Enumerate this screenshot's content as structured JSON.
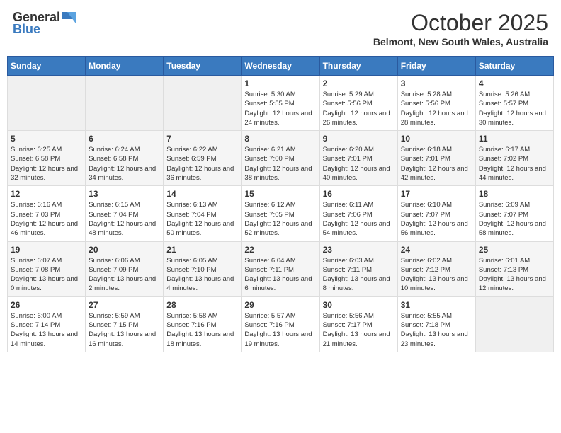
{
  "logo": {
    "general": "General",
    "blue": "Blue"
  },
  "title": "October 2025",
  "location": "Belmont, New South Wales, Australia",
  "headers": [
    "Sunday",
    "Monday",
    "Tuesday",
    "Wednesday",
    "Thursday",
    "Friday",
    "Saturday"
  ],
  "weeks": [
    [
      {
        "day": "",
        "empty": true
      },
      {
        "day": "",
        "empty": true
      },
      {
        "day": "",
        "empty": true
      },
      {
        "day": "1",
        "sunrise": "Sunrise: 5:30 AM",
        "sunset": "Sunset: 5:55 PM",
        "daylight": "Daylight: 12 hours and 24 minutes."
      },
      {
        "day": "2",
        "sunrise": "Sunrise: 5:29 AM",
        "sunset": "Sunset: 5:56 PM",
        "daylight": "Daylight: 12 hours and 26 minutes."
      },
      {
        "day": "3",
        "sunrise": "Sunrise: 5:28 AM",
        "sunset": "Sunset: 5:56 PM",
        "daylight": "Daylight: 12 hours and 28 minutes."
      },
      {
        "day": "4",
        "sunrise": "Sunrise: 5:26 AM",
        "sunset": "Sunset: 5:57 PM",
        "daylight": "Daylight: 12 hours and 30 minutes."
      }
    ],
    [
      {
        "day": "5",
        "sunrise": "Sunrise: 6:25 AM",
        "sunset": "Sunset: 6:58 PM",
        "daylight": "Daylight: 12 hours and 32 minutes."
      },
      {
        "day": "6",
        "sunrise": "Sunrise: 6:24 AM",
        "sunset": "Sunset: 6:58 PM",
        "daylight": "Daylight: 12 hours and 34 minutes."
      },
      {
        "day": "7",
        "sunrise": "Sunrise: 6:22 AM",
        "sunset": "Sunset: 6:59 PM",
        "daylight": "Daylight: 12 hours and 36 minutes."
      },
      {
        "day": "8",
        "sunrise": "Sunrise: 6:21 AM",
        "sunset": "Sunset: 7:00 PM",
        "daylight": "Daylight: 12 hours and 38 minutes."
      },
      {
        "day": "9",
        "sunrise": "Sunrise: 6:20 AM",
        "sunset": "Sunset: 7:01 PM",
        "daylight": "Daylight: 12 hours and 40 minutes."
      },
      {
        "day": "10",
        "sunrise": "Sunrise: 6:18 AM",
        "sunset": "Sunset: 7:01 PM",
        "daylight": "Daylight: 12 hours and 42 minutes."
      },
      {
        "day": "11",
        "sunrise": "Sunrise: 6:17 AM",
        "sunset": "Sunset: 7:02 PM",
        "daylight": "Daylight: 12 hours and 44 minutes."
      }
    ],
    [
      {
        "day": "12",
        "sunrise": "Sunrise: 6:16 AM",
        "sunset": "Sunset: 7:03 PM",
        "daylight": "Daylight: 12 hours and 46 minutes."
      },
      {
        "day": "13",
        "sunrise": "Sunrise: 6:15 AM",
        "sunset": "Sunset: 7:04 PM",
        "daylight": "Daylight: 12 hours and 48 minutes."
      },
      {
        "day": "14",
        "sunrise": "Sunrise: 6:13 AM",
        "sunset": "Sunset: 7:04 PM",
        "daylight": "Daylight: 12 hours and 50 minutes."
      },
      {
        "day": "15",
        "sunrise": "Sunrise: 6:12 AM",
        "sunset": "Sunset: 7:05 PM",
        "daylight": "Daylight: 12 hours and 52 minutes."
      },
      {
        "day": "16",
        "sunrise": "Sunrise: 6:11 AM",
        "sunset": "Sunset: 7:06 PM",
        "daylight": "Daylight: 12 hours and 54 minutes."
      },
      {
        "day": "17",
        "sunrise": "Sunrise: 6:10 AM",
        "sunset": "Sunset: 7:07 PM",
        "daylight": "Daylight: 12 hours and 56 minutes."
      },
      {
        "day": "18",
        "sunrise": "Sunrise: 6:09 AM",
        "sunset": "Sunset: 7:07 PM",
        "daylight": "Daylight: 12 hours and 58 minutes."
      }
    ],
    [
      {
        "day": "19",
        "sunrise": "Sunrise: 6:07 AM",
        "sunset": "Sunset: 7:08 PM",
        "daylight": "Daylight: 13 hours and 0 minutes."
      },
      {
        "day": "20",
        "sunrise": "Sunrise: 6:06 AM",
        "sunset": "Sunset: 7:09 PM",
        "daylight": "Daylight: 13 hours and 2 minutes."
      },
      {
        "day": "21",
        "sunrise": "Sunrise: 6:05 AM",
        "sunset": "Sunset: 7:10 PM",
        "daylight": "Daylight: 13 hours and 4 minutes."
      },
      {
        "day": "22",
        "sunrise": "Sunrise: 6:04 AM",
        "sunset": "Sunset: 7:11 PM",
        "daylight": "Daylight: 13 hours and 6 minutes."
      },
      {
        "day": "23",
        "sunrise": "Sunrise: 6:03 AM",
        "sunset": "Sunset: 7:11 PM",
        "daylight": "Daylight: 13 hours and 8 minutes."
      },
      {
        "day": "24",
        "sunrise": "Sunrise: 6:02 AM",
        "sunset": "Sunset: 7:12 PM",
        "daylight": "Daylight: 13 hours and 10 minutes."
      },
      {
        "day": "25",
        "sunrise": "Sunrise: 6:01 AM",
        "sunset": "Sunset: 7:13 PM",
        "daylight": "Daylight: 13 hours and 12 minutes."
      }
    ],
    [
      {
        "day": "26",
        "sunrise": "Sunrise: 6:00 AM",
        "sunset": "Sunset: 7:14 PM",
        "daylight": "Daylight: 13 hours and 14 minutes."
      },
      {
        "day": "27",
        "sunrise": "Sunrise: 5:59 AM",
        "sunset": "Sunset: 7:15 PM",
        "daylight": "Daylight: 13 hours and 16 minutes."
      },
      {
        "day": "28",
        "sunrise": "Sunrise: 5:58 AM",
        "sunset": "Sunset: 7:16 PM",
        "daylight": "Daylight: 13 hours and 18 minutes."
      },
      {
        "day": "29",
        "sunrise": "Sunrise: 5:57 AM",
        "sunset": "Sunset: 7:16 PM",
        "daylight": "Daylight: 13 hours and 19 minutes."
      },
      {
        "day": "30",
        "sunrise": "Sunrise: 5:56 AM",
        "sunset": "Sunset: 7:17 PM",
        "daylight": "Daylight: 13 hours and 21 minutes."
      },
      {
        "day": "31",
        "sunrise": "Sunrise: 5:55 AM",
        "sunset": "Sunset: 7:18 PM",
        "daylight": "Daylight: 13 hours and 23 minutes."
      },
      {
        "day": "",
        "empty": true
      }
    ]
  ]
}
